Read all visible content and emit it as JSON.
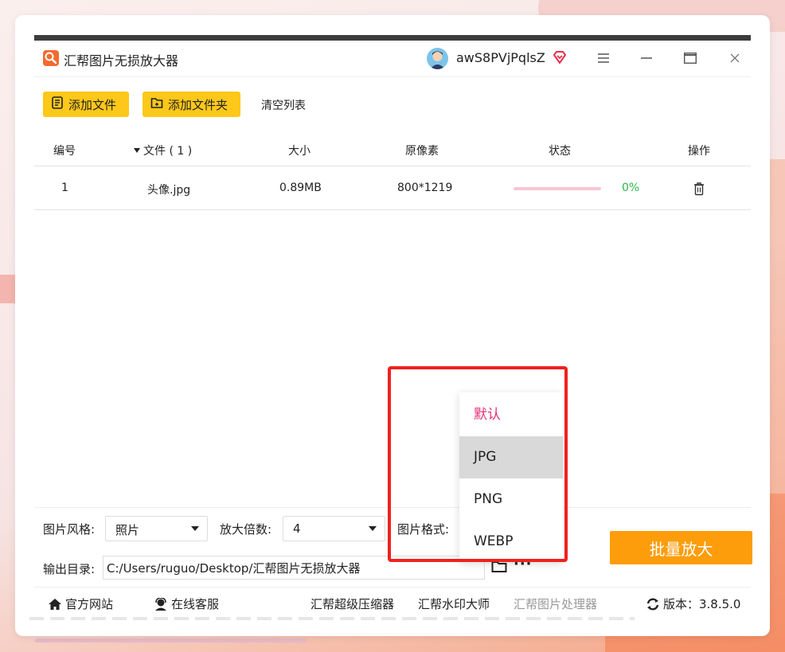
{
  "app": {
    "title": "汇帮图片无损放大器",
    "username": "awS8PVjPqlsZ"
  },
  "toolbar": {
    "add_file": "添加文件",
    "add_folder": "添加文件夹",
    "clear_list": "清空列表"
  },
  "table": {
    "headers": {
      "index": "编号",
      "file": "文件 ( 1 )",
      "size": "大小",
      "pixels": "原像素",
      "status": "状态",
      "action": "操作"
    },
    "rows": [
      {
        "index": "1",
        "file": "头像.jpg",
        "size": "0.89MB",
        "pixels": "800*1219",
        "progress": 0,
        "percent": "0%"
      }
    ]
  },
  "settings": {
    "style_label": "图片风格:",
    "style_value": "照片",
    "scale_label": "放大倍数:",
    "scale_value": "4",
    "format_label": "图片格式:",
    "output_label": "输出目录:",
    "output_path": "C:/Users/ruguo/Desktop/汇帮图片无损放大器",
    "more": "···",
    "batch_button": "批量放大"
  },
  "format_menu": {
    "options": [
      "默认",
      "JPG",
      "PNG",
      "WEBP"
    ],
    "selected": "JPG"
  },
  "footer": {
    "website": "官方网站",
    "support": "在线客服",
    "link1": "汇帮超级压缩器",
    "link2": "汇帮水印大师",
    "link3": "汇帮图片处理器",
    "version_label": "版本：3.8.5.0"
  },
  "colors": {
    "accent_yellow": "#fdc81a",
    "batch_orange": "#fd9d0b",
    "progress_green": "#2db34a",
    "default_pink": "#e4317a",
    "highlight_red": "#f0211d"
  }
}
